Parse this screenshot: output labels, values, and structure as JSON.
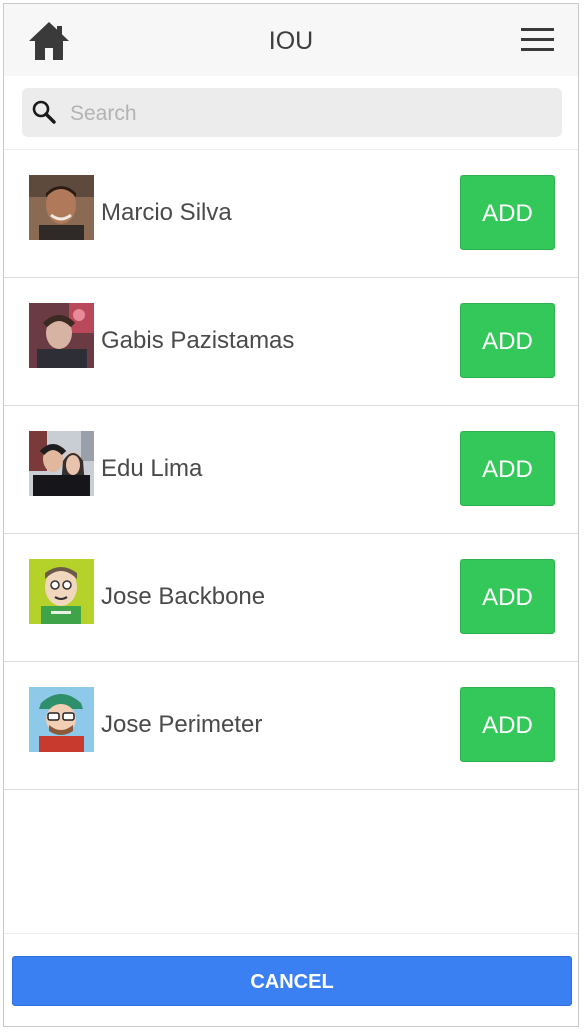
{
  "header": {
    "title": "IOU",
    "home_icon": "home-icon",
    "menu_icon": "hamburger-menu-icon"
  },
  "search": {
    "placeholder": "Search",
    "value": "",
    "icon": "search-icon"
  },
  "contacts": [
    {
      "name": "Marcio Silva",
      "add_label": "ADD"
    },
    {
      "name": "Gabis Pazistamas",
      "add_label": "ADD"
    },
    {
      "name": "Edu Lima",
      "add_label": "ADD"
    },
    {
      "name": "Jose Backbone",
      "add_label": "ADD"
    },
    {
      "name": "Jose Perimeter",
      "add_label": "ADD"
    }
  ],
  "footer": {
    "cancel_label": "CANCEL"
  },
  "colors": {
    "add_button": "#34c85a",
    "cancel_button": "#3b80f3",
    "header_bg": "#f7f7f7"
  }
}
